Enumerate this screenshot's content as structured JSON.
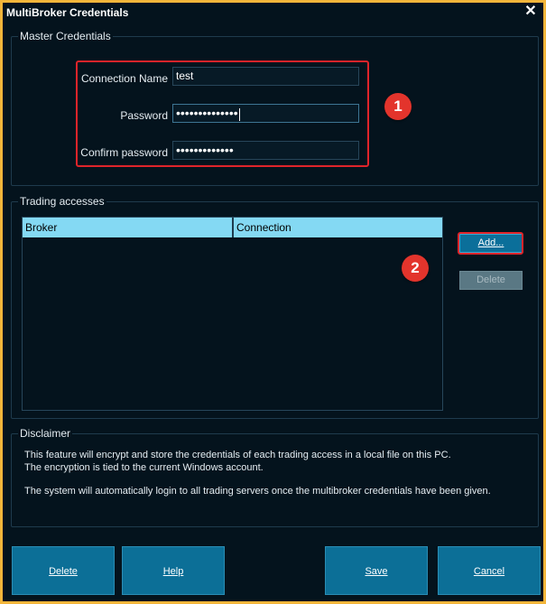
{
  "window": {
    "title": "MultiBroker Credentials",
    "close_glyph": "✕",
    "accent": "#f3b53a"
  },
  "master": {
    "label": "Master Credentials",
    "connection_name_label": "Connection Name",
    "connection_name_value": "test",
    "password_label": "Password",
    "password_dots": "••••••••••••••",
    "confirm_label": "Confirm password",
    "confirm_dots": "•••••••••••••"
  },
  "annotations": {
    "badge1": "1",
    "badge2": "2",
    "highlight_color": "#e0242a"
  },
  "trading": {
    "label": "Trading accesses",
    "columns": [
      "Broker",
      "Connection"
    ],
    "add_label": "Add...",
    "delete_label": "Delete"
  },
  "disclaimer": {
    "label": "Disclaimer",
    "line1": "This feature will encrypt and store the credentials of each trading access in a local file on this PC.",
    "line2": "The encryption is tied to the current Windows account.",
    "line3": "The system will automatically login to all trading servers once the multibroker credentials have been given."
  },
  "buttons": {
    "delete": "Delete",
    "help": "Help",
    "save": "Save",
    "cancel": "Cancel"
  }
}
